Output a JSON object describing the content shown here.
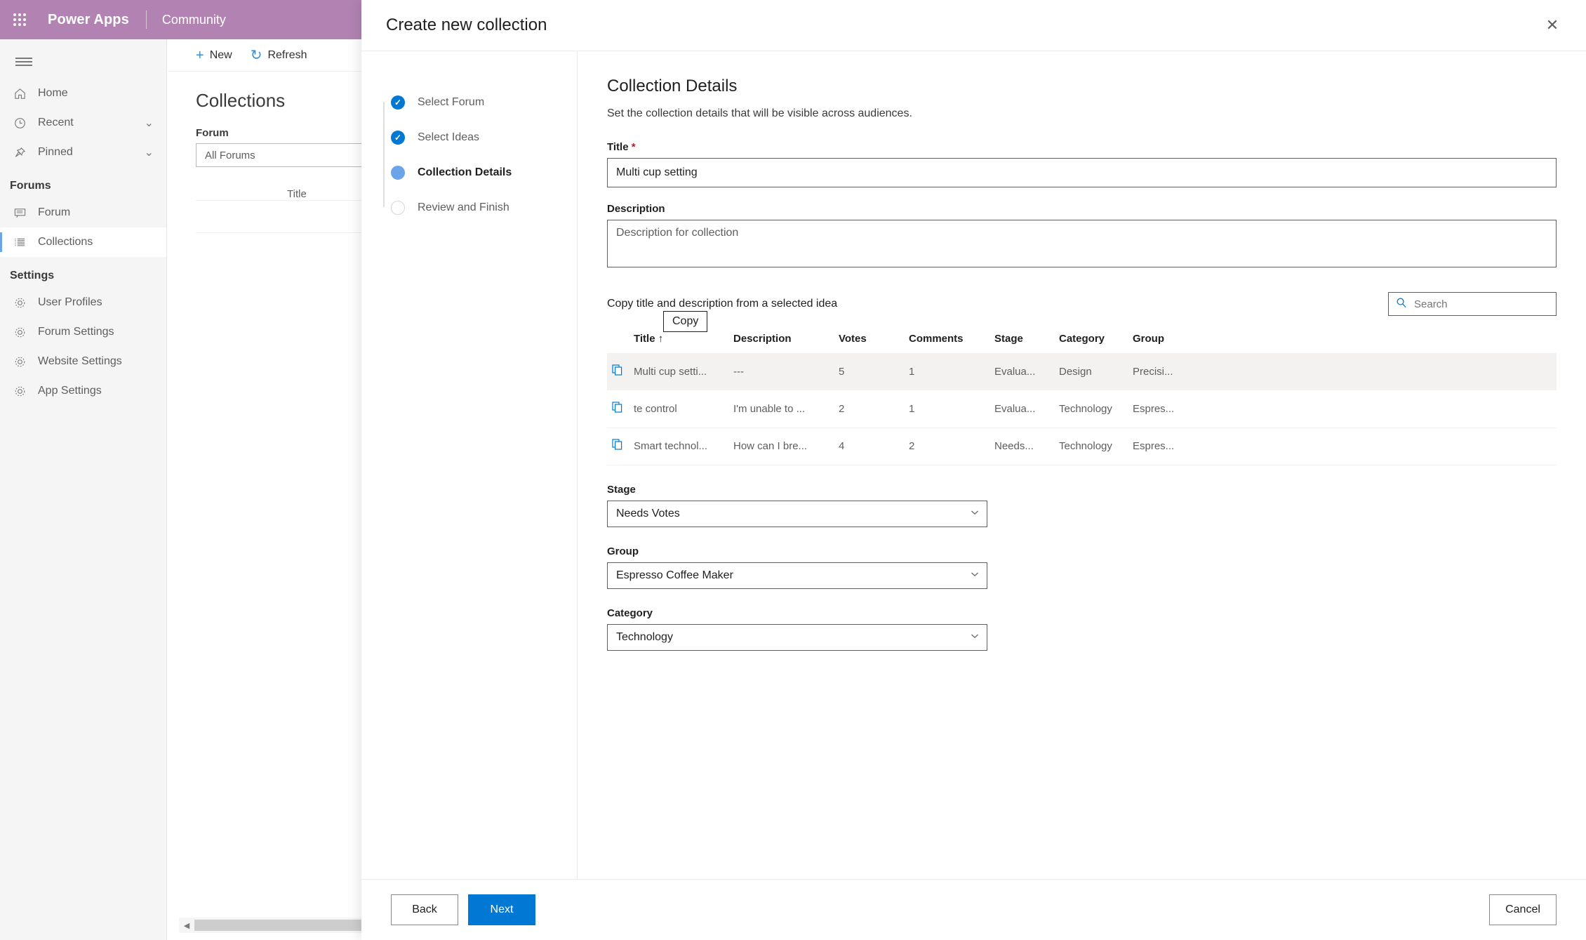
{
  "topbar": {
    "waffle_icon": "waffle-grid-icon",
    "brand": "Power Apps",
    "sub_brand": "Community"
  },
  "sidebar": {
    "hamburger_icon": "hamburger-menu-icon",
    "items": [
      {
        "label": "Home",
        "icon": "home-icon",
        "chevron": "",
        "selected": false
      },
      {
        "label": "Recent",
        "icon": "clock-icon",
        "chevron": "⌄",
        "selected": false
      },
      {
        "label": "Pinned",
        "icon": "pin-icon",
        "chevron": "⌄",
        "selected": false
      }
    ],
    "forums_header": "Forums",
    "forums_items": [
      {
        "label": "Forum",
        "icon": "forum-icon",
        "selected": false
      },
      {
        "label": "Collections",
        "icon": "collections-list-icon",
        "selected": true
      }
    ],
    "settings_header": "Settings",
    "settings_items": [
      {
        "label": "User Profiles",
        "icon": "gear-icon"
      },
      {
        "label": "Forum Settings",
        "icon": "gear-icon"
      },
      {
        "label": "Website Settings",
        "icon": "gear-icon"
      },
      {
        "label": "App Settings",
        "icon": "gear-icon"
      }
    ]
  },
  "background_page": {
    "commands": [
      {
        "label": "New",
        "glyph": "+",
        "icon": "add-icon"
      },
      {
        "label": "Refresh",
        "glyph": "↻",
        "icon": "refresh-icon"
      }
    ],
    "page_title": "Collections",
    "forum_label": "Forum",
    "forum_value": "All Forums",
    "table_header_title": "Title",
    "scroll_left_arrow": "◀"
  },
  "modal": {
    "title": "Create new collection",
    "close_icon": "close-icon",
    "steps": [
      {
        "label": "Select Forum",
        "state": "done"
      },
      {
        "label": "Select Ideas",
        "state": "done"
      },
      {
        "label": "Collection Details",
        "state": "current"
      },
      {
        "label": "Review and Finish",
        "state": "todo"
      }
    ],
    "panel": {
      "heading": "Collection Details",
      "subheading": "Set the collection details that will be visible across audiences.",
      "title_label": "Title",
      "title_required_mark": "*",
      "title_value": "Multi cup setting",
      "description_label": "Description",
      "description_value": "",
      "description_placeholder": "Description for collection",
      "copy_caption": "Copy title and description from a selected idea",
      "search_placeholder": "Search",
      "search_value": "",
      "search_icon": "search-icon",
      "tooltip_text": "Copy",
      "table": {
        "columns": [
          "",
          "Title",
          "Description",
          "Votes",
          "Comments",
          "Stage",
          "Category",
          "Group"
        ],
        "sort_column": "Title",
        "sort_indicator": "↑",
        "rows": [
          {
            "copy_icon": "copy-icon",
            "title": "Multi cup setti...",
            "description": "---",
            "votes": "5",
            "comments": "1",
            "stage": "Evalua...",
            "category": "Design",
            "group": "Precisi...",
            "selected": true
          },
          {
            "copy_icon": "copy-icon",
            "title": "te control",
            "description": "I'm unable to ...",
            "votes": "2",
            "comments": "1",
            "stage": "Evalua...",
            "category": "Technology",
            "group": "Espres...",
            "selected": false
          },
          {
            "copy_icon": "copy-icon",
            "title": "Smart technol...",
            "description": "How can I bre...",
            "votes": "4",
            "comments": "2",
            "stage": "Needs...",
            "category": "Technology",
            "group": "Espres...",
            "selected": false
          }
        ]
      },
      "stage_label": "Stage",
      "stage_value": "Needs Votes",
      "group_label": "Group",
      "group_value": "Espresso Coffee Maker",
      "category_label": "Category",
      "category_value": "Technology",
      "chevron_icon": "chevron-down-icon"
    },
    "footer": {
      "back_label": "Back",
      "next_label": "Next",
      "cancel_label": "Cancel"
    }
  },
  "colors": {
    "brand_bar": "#b283b2",
    "accent": "#0078d4",
    "current_step": "#6ba4e8",
    "required": "#a4262c",
    "row_selected": "#f3f2f1"
  }
}
